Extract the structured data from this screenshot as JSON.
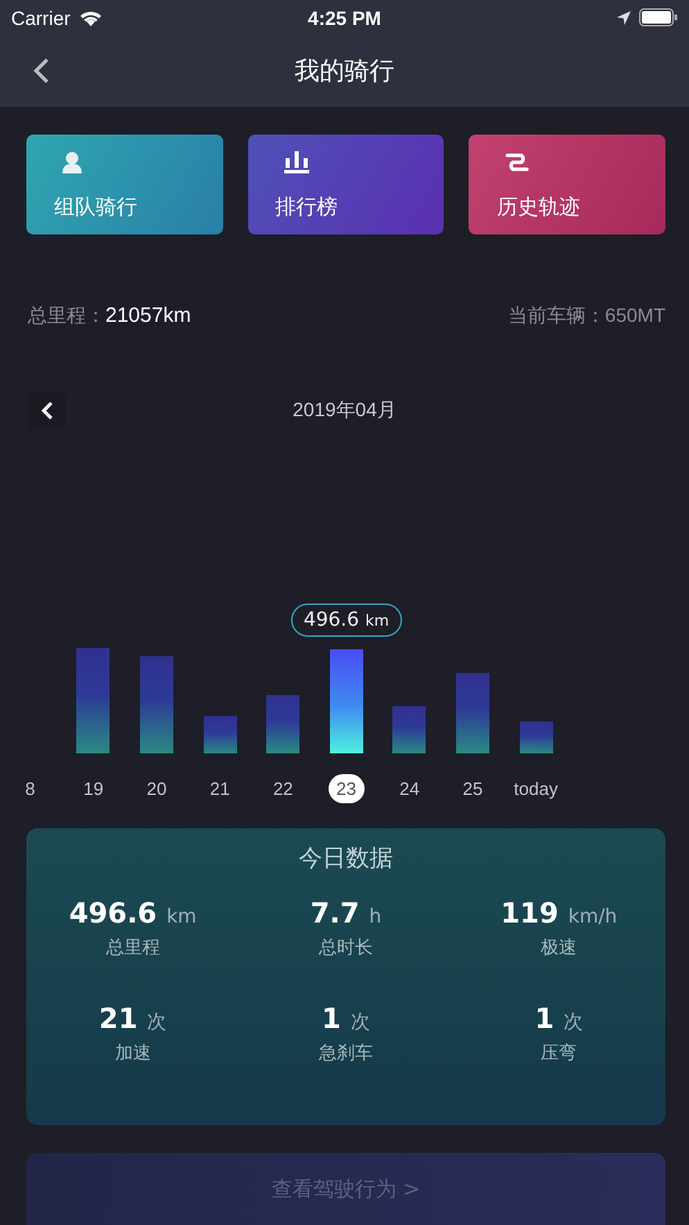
{
  "status_bar": {
    "carrier": "Carrier",
    "time": "4:25 PM"
  },
  "nav": {
    "title": "我的骑行"
  },
  "shortcuts": [
    {
      "kind": "team",
      "label": "组队骑行"
    },
    {
      "kind": "rank",
      "label": "排行榜"
    },
    {
      "kind": "history",
      "label": "历史轨迹"
    }
  ],
  "summary": {
    "distance_label": "总里程：",
    "distance": "21057km",
    "vehicle_label": "当前车辆：",
    "vehicle": "650MT"
  },
  "month": {
    "title": "2019年04月"
  },
  "tooltip": {
    "value": "496.6",
    "unit": "km"
  },
  "days": [
    {
      "label": "8",
      "selected": false
    },
    {
      "label": "19",
      "selected": false
    },
    {
      "label": "20",
      "selected": false
    },
    {
      "label": "21",
      "selected": false
    },
    {
      "label": "22",
      "selected": false
    },
    {
      "label": "23",
      "selected": true
    },
    {
      "label": "24",
      "selected": false
    },
    {
      "label": "25",
      "selected": false
    },
    {
      "label": "today",
      "selected": false
    }
  ],
  "today": {
    "title": "今日数据",
    "stats": [
      {
        "value": "496.6",
        "unit": "km",
        "label": "总里程"
      },
      {
        "value": "7.7",
        "unit": "h",
        "label": "总时长"
      },
      {
        "value": "119",
        "unit": "km/h",
        "label": "极速"
      },
      {
        "value": "21",
        "unit": "次",
        "label": "加速"
      },
      {
        "value": "1",
        "unit": "次",
        "label": "急刹车"
      },
      {
        "value": "1",
        "unit": "次",
        "label": "压弯"
      }
    ]
  },
  "behavior_button": {
    "label": "查看驾驶行为",
    "arrow": ">"
  }
}
